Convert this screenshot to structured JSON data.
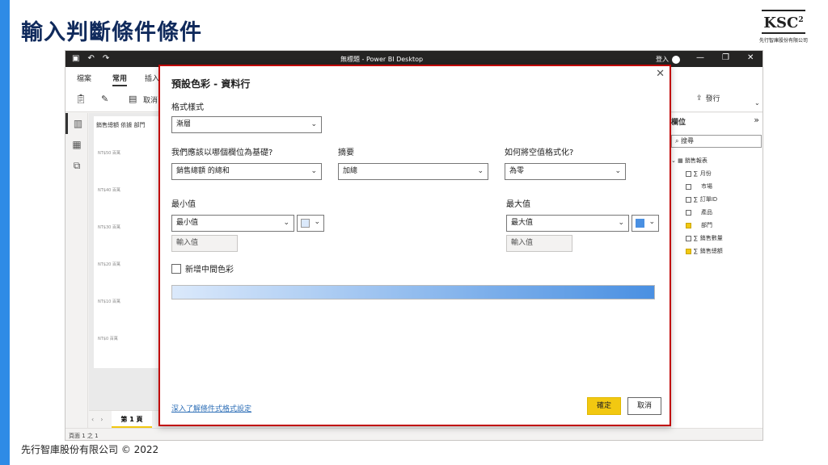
{
  "slide": {
    "title": "輸入判斷條件條件",
    "logo_text": "KSC",
    "logo_sup": "2",
    "logo_sub": "先行智庫股份有限公司",
    "footer": "先行智庫股份有限公司 © 2022"
  },
  "window": {
    "title": "無標題 - Power BI Desktop",
    "login": "登入",
    "tabs": [
      "檔案",
      "常用",
      "插入"
    ],
    "ribbon_cancel": "取消",
    "publish": "發行",
    "page_tab": "第 1 頁",
    "status": "頁面 1 之 1"
  },
  "visual": {
    "title": "銷售總額 依據 部門",
    "y_labels": [
      "NT$50 百萬",
      "NT$40 百萬",
      "NT$30 百萬",
      "NT$20 百萬",
      "NT$10 百萬",
      "NT$0 百萬"
    ]
  },
  "fields_pane": {
    "header": "欄位",
    "search_placeholder": "搜尋",
    "table": "銷售報表",
    "items": [
      {
        "label": "月份",
        "sigma": true,
        "checked": false
      },
      {
        "label": "市場",
        "sigma": false,
        "checked": false
      },
      {
        "label": "訂單ID",
        "sigma": true,
        "checked": false
      },
      {
        "label": "產品",
        "sigma": false,
        "checked": false
      },
      {
        "label": "部門",
        "sigma": false,
        "checked": true
      },
      {
        "label": "銷售數量",
        "sigma": true,
        "checked": false
      },
      {
        "label": "銷售總額",
        "sigma": true,
        "checked": true
      }
    ]
  },
  "dialog": {
    "title": "預設色彩 - 資料行",
    "format_style_label": "格式樣式",
    "format_style_value": "漸層",
    "base_field_label": "我們應該以哪個欄位為基礎?",
    "base_field_value": "銷售總額 的總和",
    "summary_label": "摘要",
    "summary_value": "加總",
    "empty_label": "如何將空值格式化?",
    "empty_value": "為零",
    "min_label": "最小值",
    "min_value": "最小值",
    "min_input_placeholder": "輸入值",
    "max_label": "最大值",
    "max_value": "最大值",
    "max_input_placeholder": "輸入值",
    "middle_color_label": "新增中間色彩",
    "learn_more": "深入了解條件式格式設定",
    "ok": "確定",
    "cancel": "取消",
    "min_color": "#dbe9fb",
    "max_color": "#4a90e2"
  }
}
